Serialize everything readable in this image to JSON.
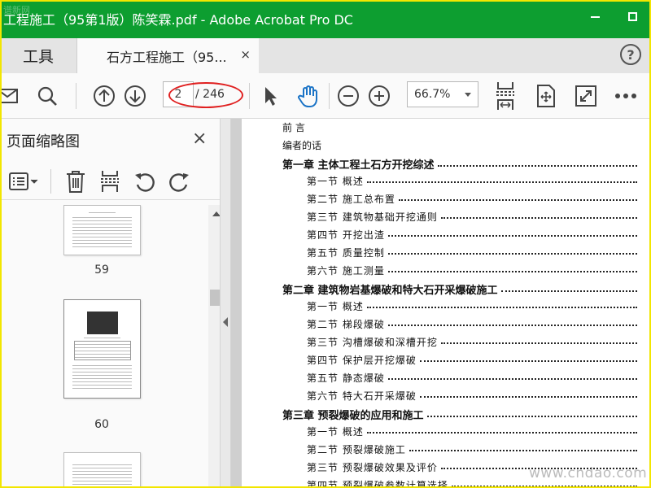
{
  "window": {
    "title": "工程施工（95第1版）陈笑霖.pdf - Adobe Acrobat Pro DC",
    "controls": {
      "minimize_icon": "minimize-icon",
      "maximize_icon": "maximize-icon"
    }
  },
  "tabs": {
    "tools_label": "工具",
    "doc_label": "石方工程施工（95...",
    "close_symbol": "×",
    "help_symbol": "?"
  },
  "toolbar": {
    "current_page": "2",
    "total_pages": "/ 246",
    "zoom": "66.7%",
    "icons": [
      "mail-icon",
      "search-icon",
      "page-up-icon",
      "page-down-icon",
      "select-cursor-icon",
      "hand-tool-icon",
      "zoom-out-icon",
      "zoom-in-icon",
      "fit-width-icon",
      "rotate-page-icon",
      "full-screen-icon",
      "more-icon"
    ]
  },
  "sidebar": {
    "title": "页面缩略图",
    "close_symbol": "×",
    "tools": [
      "options-menu-icon",
      "delete-icon",
      "extract-icon",
      "undo-icon",
      "redo-icon"
    ],
    "thumbnails": [
      {
        "page": "59"
      },
      {
        "page": "60"
      },
      {
        "page": ""
      }
    ]
  },
  "document": {
    "toc": [
      {
        "text": "前  言",
        "level": 0,
        "dots": false
      },
      {
        "text": "编者的话",
        "level": 0,
        "dots": false
      },
      {
        "text": "第一章  主体工程土石方开挖综述",
        "level": 1,
        "dots": true
      },
      {
        "text": "第一节  概述",
        "level": 2,
        "dots": true
      },
      {
        "text": "第二节  施工总布置",
        "level": 2,
        "dots": true
      },
      {
        "text": "第三节  建筑物基础开挖通则",
        "level": 2,
        "dots": true
      },
      {
        "text": "第四节  开挖出渣",
        "level": 2,
        "dots": true
      },
      {
        "text": "第五节  质量控制",
        "level": 2,
        "dots": true
      },
      {
        "text": "第六节  施工测量",
        "level": 2,
        "dots": true
      },
      {
        "text": "第二章  建筑物岩基爆破和特大石开采爆破施工",
        "level": 1,
        "dots": true
      },
      {
        "text": "第一节  概述",
        "level": 2,
        "dots": true
      },
      {
        "text": "第二节  梯段爆破",
        "level": 2,
        "dots": true
      },
      {
        "text": "第三节  沟槽爆破和深槽开挖",
        "level": 2,
        "dots": true
      },
      {
        "text": "第四节  保护层开挖爆破",
        "level": 2,
        "dots": true
      },
      {
        "text": "第五节  静态爆破",
        "level": 2,
        "dots": true
      },
      {
        "text": "第六节  特大石开采爆破",
        "level": 2,
        "dots": true
      },
      {
        "text": "第三章  预裂爆破的应用和施工",
        "level": 1,
        "dots": true
      },
      {
        "text": "第一节  概述",
        "level": 2,
        "dots": true
      },
      {
        "text": "第二节  预裂爆破施工",
        "level": 2,
        "dots": true
      },
      {
        "text": "第三节  预裂爆破效果及评价",
        "level": 2,
        "dots": true
      },
      {
        "text": "第四节  预裂爆破参数计算选择",
        "level": 2,
        "dots": true
      }
    ]
  },
  "watermarks": {
    "top_left": "谱新网",
    "bottom_right": "www.cndao.com"
  },
  "colors": {
    "titlebar": "#0d9e30",
    "annotation": "#e02020",
    "frame": "#f2e600"
  }
}
